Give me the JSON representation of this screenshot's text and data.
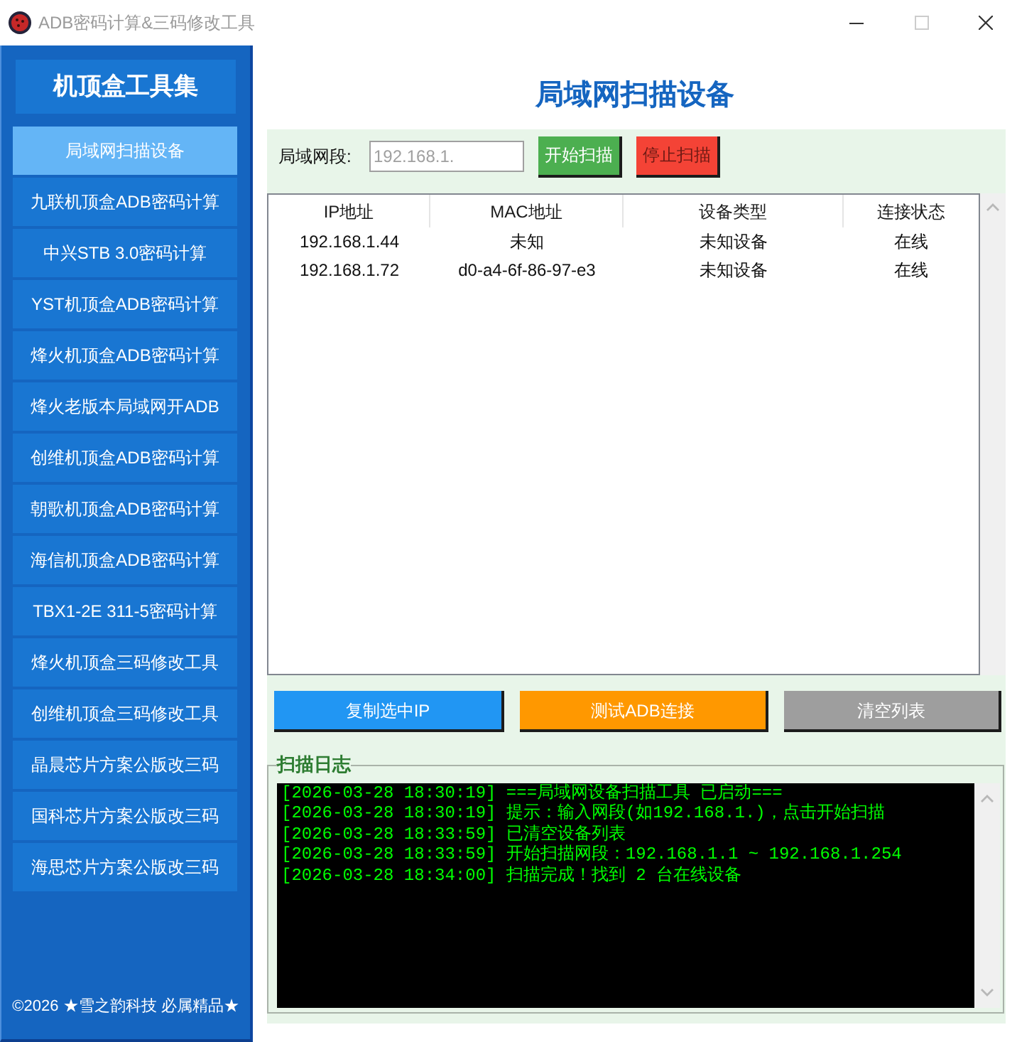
{
  "window": {
    "title": "ADB密码计算&三码修改工具",
    "maximize_disabled": true
  },
  "sidebar": {
    "title": "机顶盒工具集",
    "items": [
      {
        "label": "局域网扫描设备",
        "selected": true
      },
      {
        "label": "九联机顶盒ADB密码计算",
        "selected": false
      },
      {
        "label": "中兴STB 3.0密码计算",
        "selected": false
      },
      {
        "label": "YST机顶盒ADB密码计算",
        "selected": false
      },
      {
        "label": "烽火机顶盒ADB密码计算",
        "selected": false
      },
      {
        "label": "烽火老版本局域网开ADB",
        "selected": false
      },
      {
        "label": "创维机顶盒ADB密码计算",
        "selected": false
      },
      {
        "label": "朝歌机顶盒ADB密码计算",
        "selected": false
      },
      {
        "label": "海信机顶盒ADB密码计算",
        "selected": false
      },
      {
        "label": "TBX1-2E 311-5密码计算",
        "selected": false
      },
      {
        "label": "烽火机顶盒三码修改工具",
        "selected": false
      },
      {
        "label": "创维机顶盒三码修改工具",
        "selected": false
      },
      {
        "label": "晶晨芯片方案公版改三码",
        "selected": false
      },
      {
        "label": "国科芯片方案公版改三码",
        "selected": false
      },
      {
        "label": "海思芯片方案公版改三码",
        "selected": false
      }
    ],
    "footer": "©2026 ★雪之韵科技 必属精品★"
  },
  "page_title": "局域网扫描设备",
  "scan_bar": {
    "label": "局域网段:",
    "range_field": {
      "placeholder": "192.168.1."
    },
    "buttons": [
      {
        "label": "开始扫描",
        "kind": "start",
        "disabled": false
      },
      {
        "label": "停止扫描",
        "kind": "stop",
        "disabled": true
      }
    ]
  },
  "device_table": {
    "columns": [
      "IP地址",
      "MAC地址",
      "设备类型",
      "连接状态"
    ],
    "rows": [
      [
        "192.168.1.44",
        "未知",
        "未知设备",
        "在线"
      ],
      [
        "192.168.1.72",
        "d0-a4-6f-86-97-e3",
        "未知设备",
        "在线"
      ]
    ]
  },
  "actions": [
    {
      "label": "复制选中IP",
      "kind": "copy"
    },
    {
      "label": "测试ADB连接",
      "kind": "test"
    },
    {
      "label": "清空列表",
      "kind": "clear"
    }
  ],
  "log": {
    "title": "扫描日志",
    "lines": [
      "[2026-03-28 18:30:19] ===局域网设备扫描工具 已启动===",
      "[2026-03-28 18:30:19] 提示：输入网段(如192.168.1.)，点击开始扫描",
      "[2026-03-28 18:33:59] 已清空设备列表",
      "[2026-03-28 18:33:59] 开始扫描网段：192.168.1.1 ~ 192.168.1.254",
      "[2026-03-28 18:34:00] 扫描完成！找到 2 台在线设备"
    ]
  }
}
